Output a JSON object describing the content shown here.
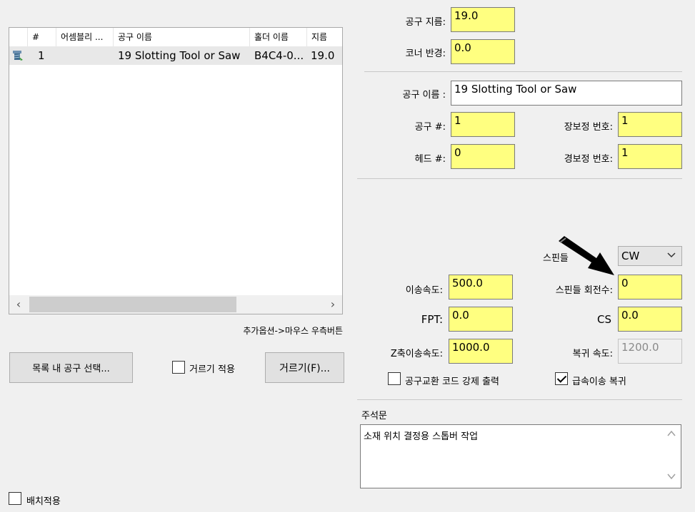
{
  "tool_table": {
    "columns": [
      "#",
      "어셈블리 ...",
      "공구 이름",
      "홀더 이름",
      "지름"
    ],
    "rows": [
      {
        "num": "1",
        "assembly": "",
        "tool_name": "19 Slotting Tool or Saw",
        "holder_name": "B4C4-0...",
        "diameter": "19.0"
      }
    ]
  },
  "hint_text": "추가옵션->마우스 우측버튼",
  "buttons": {
    "select_tool": "목록 내 공구 선택...",
    "filter": "거르기(F)..."
  },
  "checkboxes": {
    "apply_filter": {
      "label": "거르기 적용",
      "checked": false
    },
    "batch_apply": {
      "label": "배치적용",
      "checked": false
    },
    "force_tool_change": {
      "label": "공구교환 코드 강제 출력",
      "checked": false
    },
    "rapid_return": {
      "label": "급속이송 복귀",
      "checked": true
    }
  },
  "params": {
    "tool_diameter": {
      "label": "공구 지름:",
      "value": "19.0"
    },
    "corner_radius": {
      "label": "코너 반경:",
      "value": "0.0"
    },
    "tool_name": {
      "label": "공구 이름 :",
      "value": "19 Slotting Tool or Saw"
    },
    "tool_number": {
      "label": "공구 #:",
      "value": "1"
    },
    "length_offset": {
      "label": "장보정 번호:",
      "value": "1"
    },
    "head_number": {
      "label": "헤드 #:",
      "value": "0"
    },
    "dia_offset": {
      "label": "경보정 번호:",
      "value": "1"
    },
    "spindle_dir": {
      "label": "스핀들 ",
      "value": "CW"
    },
    "feed_rate": {
      "label": "이송속도:",
      "value": "500.0"
    },
    "spindle_speed": {
      "label": "스핀들 회전수:",
      "value": "0"
    },
    "fpt": {
      "label": "FPT:",
      "value": "0.0"
    },
    "cs": {
      "label": "CS",
      "value": "0.0"
    },
    "z_feed": {
      "label": "Z축이송속도:",
      "value": "1000.0"
    },
    "retract_speed": {
      "label": "복귀 속도:",
      "value": "1200.0"
    }
  },
  "comment": {
    "label": "주석문",
    "value": "소재 위치 결정용 스톱버 작업"
  },
  "colors": {
    "input_highlight": "#ffff80",
    "panel_bg": "#f0f0f0"
  }
}
